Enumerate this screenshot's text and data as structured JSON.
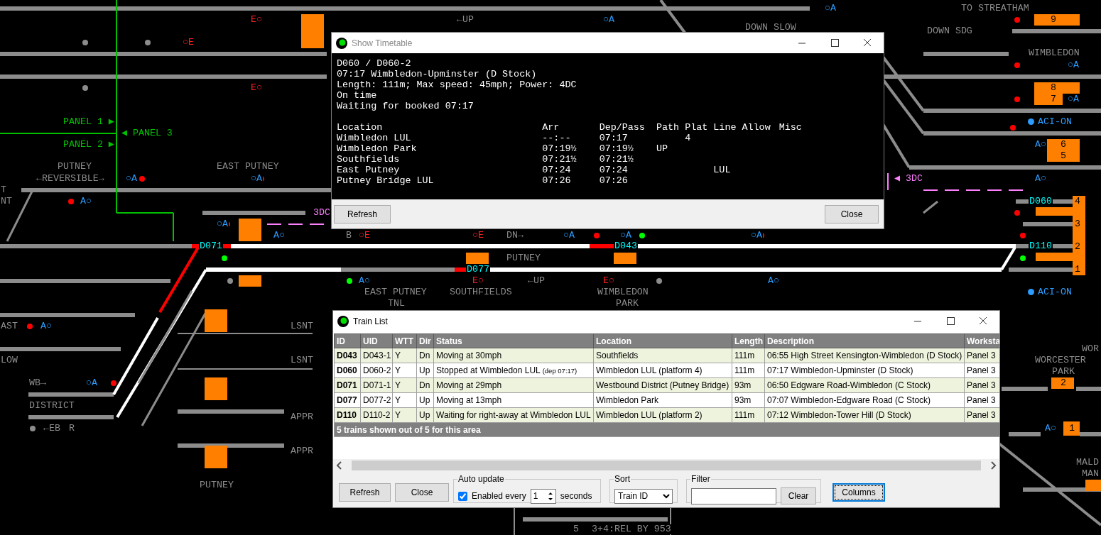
{
  "diagram": {
    "labels": [
      {
        "text": "○A",
        "kind": "code-a"
      },
      {
        "text": "TO STREATHAM",
        "kind": "location"
      },
      {
        "text": "E○",
        "kind": "code-e"
      },
      {
        "text": "←UP",
        "kind": "location"
      },
      {
        "text": "○A",
        "kind": "code-a"
      },
      {
        "text": "9",
        "kind": "berth"
      },
      {
        "text": "DOWN SLOW",
        "kind": "location"
      },
      {
        "text": "DOWN SDG",
        "kind": "location"
      },
      {
        "text": "○E",
        "kind": "code-e"
      },
      {
        "text": "WIMBLEDON",
        "kind": "location"
      },
      {
        "text": "○A",
        "kind": "code-a"
      },
      {
        "text": "E○",
        "kind": "code-e"
      },
      {
        "text": "8",
        "kind": "berth"
      },
      {
        "text": "7",
        "kind": "berth"
      },
      {
        "text": "○A",
        "kind": "code-a"
      },
      {
        "text": "PANEL 1 ▶",
        "kind": "panel"
      },
      {
        "text": "ACI-ON",
        "kind": "aci"
      },
      {
        "text": "◀ PANEL 3",
        "kind": "panel"
      },
      {
        "text": "PANEL 2 ▶",
        "kind": "panel"
      },
      {
        "text": "A○",
        "kind": "code-a"
      },
      {
        "text": "6",
        "kind": "berth"
      },
      {
        "text": "5",
        "kind": "berth"
      },
      {
        "text": "PUTNEY",
        "kind": "location"
      },
      {
        "text": "EAST PUTNEY",
        "kind": "location"
      },
      {
        "text": "←REVERSIBLE→",
        "kind": "location"
      },
      {
        "text": "○A",
        "kind": "code-a"
      },
      {
        "text": "○A",
        "kind": "code-a"
      },
      {
        "text": "◀ 3DC",
        "kind": "dc"
      },
      {
        "text": "A○",
        "kind": "code-a"
      },
      {
        "text": "T",
        "kind": "location"
      },
      {
        "text": "NT",
        "kind": "location"
      },
      {
        "text": "A○",
        "kind": "code-a"
      },
      {
        "text": "D060",
        "kind": "train"
      },
      {
        "text": "4",
        "kind": "berth"
      },
      {
        "text": "3DC",
        "kind": "dc"
      },
      {
        "text": "○A",
        "kind": "code-a"
      },
      {
        "text": "3",
        "kind": "berth"
      },
      {
        "text": "A○",
        "kind": "code-a"
      },
      {
        "text": "B",
        "kind": "location"
      },
      {
        "text": "○E",
        "kind": "code-e"
      },
      {
        "text": "○E",
        "kind": "code-e"
      },
      {
        "text": "DN→",
        "kind": "location"
      },
      {
        "text": "○A",
        "kind": "code-a"
      },
      {
        "text": "○A",
        "kind": "code-a"
      },
      {
        "text": "○A",
        "kind": "code-a"
      },
      {
        "text": "D071",
        "kind": "train"
      },
      {
        "text": "D043",
        "kind": "train"
      },
      {
        "text": "D110",
        "kind": "train"
      },
      {
        "text": "2",
        "kind": "berth"
      },
      {
        "text": "PUTNEY",
        "kind": "location"
      },
      {
        "text": "D077",
        "kind": "train"
      },
      {
        "text": "1",
        "kind": "berth"
      },
      {
        "text": "A○",
        "kind": "code-a"
      },
      {
        "text": "E○",
        "kind": "code-e"
      },
      {
        "text": "←UP",
        "kind": "location"
      },
      {
        "text": "E○",
        "kind": "code-e"
      },
      {
        "text": "A○",
        "kind": "code-a"
      },
      {
        "text": "EAST PUTNEY",
        "kind": "location"
      },
      {
        "text": "SOUTHFIELDS",
        "kind": "location"
      },
      {
        "text": "WIMBLEDON",
        "kind": "location"
      },
      {
        "text": "ACI-ON",
        "kind": "aci"
      },
      {
        "text": "TNL",
        "kind": "location"
      },
      {
        "text": "PARK",
        "kind": "location"
      },
      {
        "text": "AST",
        "kind": "location"
      },
      {
        "text": "A○",
        "kind": "code-a"
      },
      {
        "text": "LSNT",
        "kind": "location"
      },
      {
        "text": "WOR",
        "kind": "location"
      },
      {
        "text": "LOW",
        "kind": "location"
      },
      {
        "text": "LSNT",
        "kind": "location"
      },
      {
        "text": "WORCESTER",
        "kind": "location"
      },
      {
        "text": "PARK",
        "kind": "location"
      },
      {
        "text": "WB→",
        "kind": "location"
      },
      {
        "text": "○A",
        "kind": "code-a"
      },
      {
        "text": "2",
        "kind": "berth"
      },
      {
        "text": "DISTRICT",
        "kind": "location"
      },
      {
        "text": "APPR",
        "kind": "location"
      },
      {
        "text": "←EB",
        "kind": "location"
      },
      {
        "text": "R",
        "kind": "location"
      },
      {
        "text": "A○",
        "kind": "code-a"
      },
      {
        "text": "1",
        "kind": "berth"
      },
      {
        "text": "APPR",
        "kind": "location"
      },
      {
        "text": "MALD",
        "kind": "location"
      },
      {
        "text": "MAN",
        "kind": "location"
      },
      {
        "text": "PUTNEY",
        "kind": "location"
      },
      {
        "text": "5",
        "kind": "location"
      },
      {
        "text": "3+4:REL BY 953",
        "kind": "location"
      }
    ]
  },
  "timetable_window": {
    "title": "Show Timetable",
    "active": false,
    "header_lines": [
      "D060 / D060-2",
      "07:17 Wimbledon-Upminster (D Stock)",
      "Length: 111m; Max speed: 45mph; Power: 4DC",
      "On time",
      "Waiting for booked 07:17"
    ],
    "columns": [
      "Location",
      "Arr",
      "Dep/Pass",
      "Path",
      "Plat",
      "Line",
      "Allow",
      "Misc"
    ],
    "rows": [
      {
        "location": "Wimbledon LUL",
        "arr": "--:--",
        "dep": "07:17",
        "plat": "4"
      },
      {
        "location": "Wimbledon Park",
        "arr": "07:19½",
        "dep": "07:19½",
        "path": "UP"
      },
      {
        "location": "Southfields",
        "arr": "07:21½",
        "dep": "07:21½"
      },
      {
        "location": "East Putney",
        "arr": "07:24",
        "dep": "07:24",
        "line": "LUL"
      },
      {
        "location": "Putney Bridge LUL",
        "arr": "07:26",
        "dep": "07:26"
      }
    ],
    "buttons": [
      "Refresh",
      "Close"
    ]
  },
  "train_list_window": {
    "title": "Train List",
    "active": true,
    "columns": [
      "ID",
      "UID",
      "WTT",
      "Dir",
      "Status",
      "Location",
      "Length",
      "Description",
      "Worksta"
    ],
    "rows": [
      {
        "cells": [
          "D043",
          "D043-1",
          "Y",
          "Dn",
          "Moving at 30mph",
          "Southfields",
          "111m",
          "06:55 High Street Kensington-Wimbledon (D Stock)",
          "Panel 3"
        ]
      },
      {
        "cells": [
          "D060",
          "D060-2",
          "Y",
          "Up",
          "Stopped at Wimbledon LUL",
          "Wimbledon LUL (platform 4)",
          "111m",
          "07:17 Wimbledon-Upminster (D Stock)",
          "Panel 3"
        ],
        "status_note": "(dep 07:17)"
      },
      {
        "cells": [
          "D071",
          "D071-1",
          "Y",
          "Dn",
          "Moving at 29mph",
          "Westbound District (Putney Bridge)",
          "93m",
          "06:50 Edgware Road-Wimbledon (C Stock)",
          "Panel 3"
        ]
      },
      {
        "cells": [
          "D077",
          "D077-2",
          "Y",
          "Up",
          "Moving at 13mph",
          "Wimbledon Park",
          "93m",
          "07:07 Wimbledon-Edgware Road (C Stock)",
          "Panel 3"
        ]
      },
      {
        "cells": [
          "D110",
          "D110-2",
          "Y",
          "Up",
          "Waiting for right-away at Wimbledon LUL",
          "Wimbledon LUL (platform 2)",
          "111m",
          "07:12 Wimbledon-Tower Hill (D Stock)",
          "Panel 3"
        ]
      }
    ],
    "summary": "5 trains shown out of 5 for this area",
    "buttons": [
      "Refresh",
      "Close"
    ],
    "auto_update": {
      "legend": "Auto update",
      "label": "Enabled every",
      "checked": true,
      "value": "1",
      "unit": "seconds"
    },
    "sort": {
      "legend": "Sort",
      "value": "Train ID"
    },
    "filter": {
      "legend": "Filter",
      "clear_button": "Clear"
    },
    "columns_button": "Columns"
  }
}
